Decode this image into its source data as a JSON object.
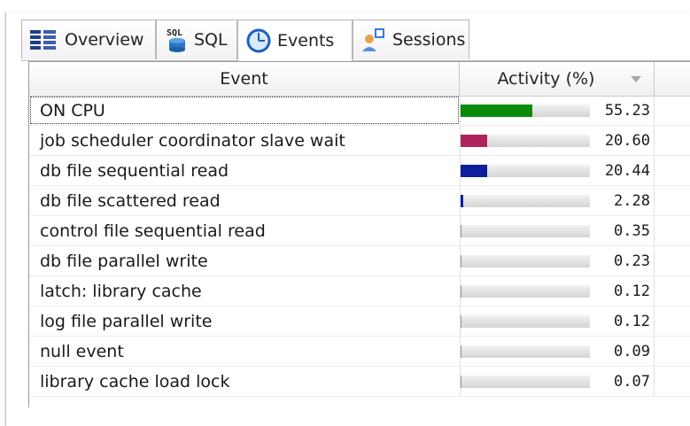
{
  "tabs": [
    {
      "label": "Overview",
      "icon": "overview-icon"
    },
    {
      "label": "SQL",
      "icon": "sql-icon",
      "icon_text": "SQL"
    },
    {
      "label": "Events",
      "icon": "clock-icon",
      "active": true
    },
    {
      "label": "Sessions",
      "icon": "sessions-icon"
    }
  ],
  "table": {
    "headers": {
      "event": "Event",
      "activity": "Activity (%)"
    },
    "sort": "descending",
    "rows": [
      {
        "event": "ON CPU",
        "activity": "55.23",
        "pct": 55.23,
        "color": "#0a8a0a"
      },
      {
        "event": "job scheduler coordinator slave wait",
        "activity": "20.60",
        "pct": 20.6,
        "color": "#b0245e"
      },
      {
        "event": "db file sequential read",
        "activity": "20.44",
        "pct": 20.44,
        "color": "#0d1f9a"
      },
      {
        "event": "db file scattered read",
        "activity": "2.28",
        "pct": 2.28,
        "color": "#0d1f9a"
      },
      {
        "event": "control file sequential read",
        "activity": "0.35",
        "pct": 0.35,
        "color": "#999999"
      },
      {
        "event": "db file parallel write",
        "activity": "0.23",
        "pct": 0.23,
        "color": "#999999"
      },
      {
        "event": "latch: library cache",
        "activity": "0.12",
        "pct": 0.12,
        "color": "#999999"
      },
      {
        "event": "log file parallel write",
        "activity": "0.12",
        "pct": 0.12,
        "color": "#999999"
      },
      {
        "event": "null event",
        "activity": "0.09",
        "pct": 0.09,
        "color": "#999999"
      },
      {
        "event": "library cache load lock",
        "activity": "0.07",
        "pct": 0.07,
        "color": "#999999"
      }
    ]
  }
}
